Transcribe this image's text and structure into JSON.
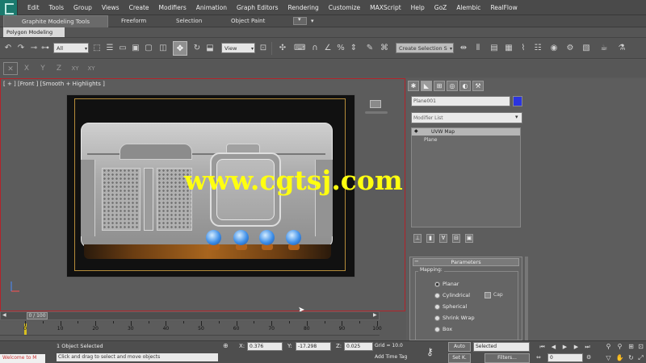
{
  "menu": [
    "Edit",
    "Tools",
    "Group",
    "Views",
    "Create",
    "Modifiers",
    "Animation",
    "Graph Editors",
    "Rendering",
    "Customize",
    "MAXScript",
    "Help",
    "GoZ",
    "Alembic",
    "RealFlow"
  ],
  "ribbon": {
    "tabs": [
      "Graphite Modeling Tools",
      "Freeform",
      "Selection",
      "Object Paint"
    ],
    "subtab": "Polygon Modeling"
  },
  "toolbar": {
    "selection_filter": "All",
    "reference_coord": "View",
    "named_selection": "Create Selection S"
  },
  "axis_constraints": [
    "X",
    "Y",
    "Z",
    "XY",
    "XY"
  ],
  "viewport": {
    "label": "[ + ] [Front ] [Smooth + Highlights ]",
    "watermark": "www.cgtsj.com"
  },
  "command_panel": {
    "object_name": "Plane001",
    "object_color": "#2b34e0",
    "modifier_list": "Modifier List",
    "stack": [
      "UVW Map",
      "Plane"
    ],
    "rollout_title": "Parameters",
    "mapping_label": "Mapping:",
    "mapping_options": [
      {
        "label": "Planar",
        "selected": true
      },
      {
        "label": "Cylindrical",
        "selected": false
      },
      {
        "label": "Spherical",
        "selected": false
      },
      {
        "label": "Shrink Wrap",
        "selected": false
      },
      {
        "label": "Box",
        "selected": false
      }
    ],
    "cap_label": "Cap"
  },
  "timeline": {
    "slider": "0 / 100",
    "ticks": [
      "0",
      "10",
      "20",
      "30",
      "40",
      "50",
      "60",
      "70",
      "80",
      "90",
      "100"
    ]
  },
  "status": {
    "maxscript": "Welcome to M",
    "selection": "1 Object Selected",
    "prompt": "Click and drag to select and move objects",
    "x": "0.376",
    "y": "-17.298",
    "z": "0.025",
    "grid": "Grid = 10.0",
    "add_time_tag": "Add Time Tag",
    "auto_key": "Auto",
    "set_key": "Set K.",
    "key_filter": "Selected",
    "filters": "Filters...",
    "frame": "0"
  }
}
